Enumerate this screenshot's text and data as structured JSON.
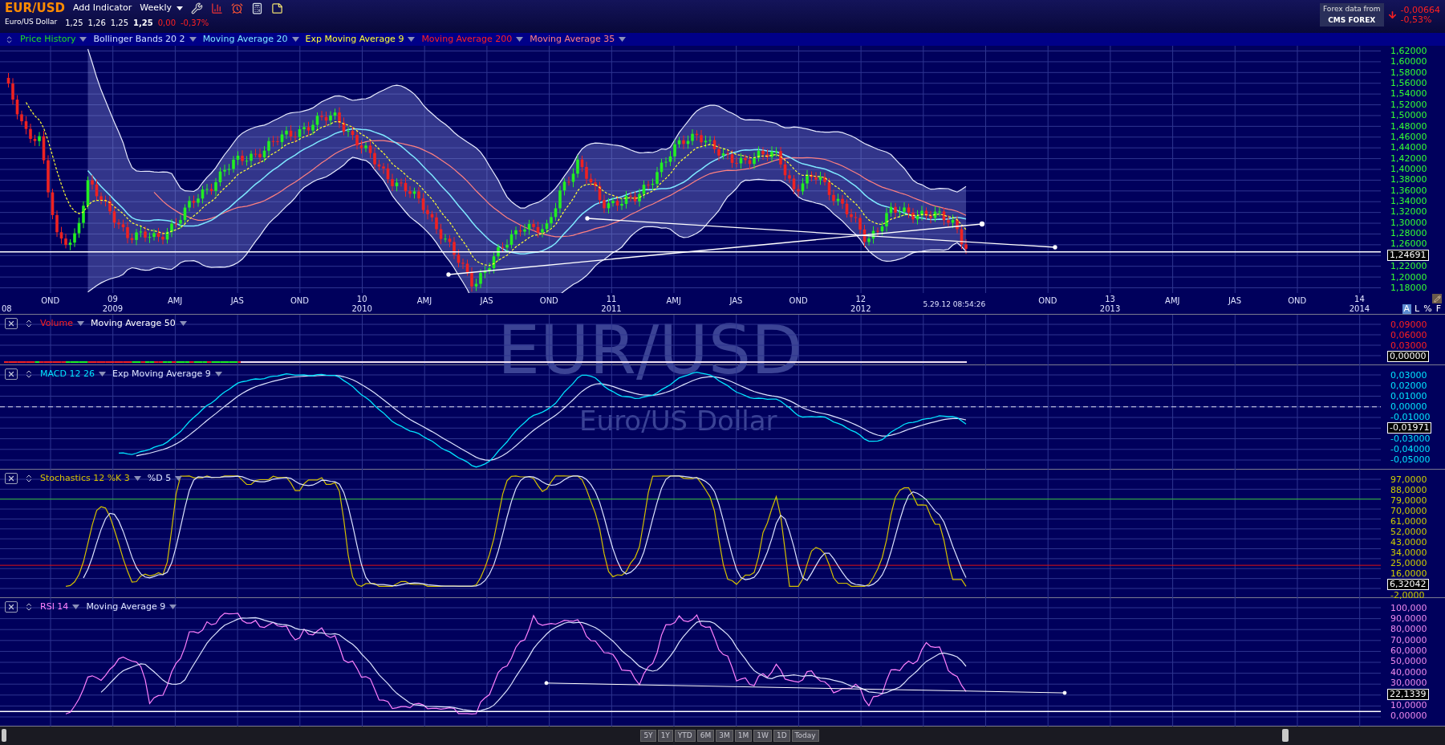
{
  "header": {
    "symbol": "EUR/USD",
    "add_indicator": "Add Indicator",
    "interval": "Weekly",
    "name": "Euro/US Dollar",
    "quote": [
      "1,25",
      "1,26",
      "1,25",
      "1,25"
    ],
    "change": "0,00",
    "change_percent": "-0,37%",
    "data_source": {
      "label": "Forex data from",
      "logo_text": "CMS FOREX"
    },
    "last_change": "-0,00664",
    "last_change_percent": "-0,53%"
  },
  "main_chart": {
    "indicators": [
      {
        "label": "Price History"
      },
      {
        "label": "Bollinger Bands 20 2"
      },
      {
        "label": "Moving Average 20"
      },
      {
        "label": "Exp Moving Average 9"
      },
      {
        "label": "Moving Average 200"
      },
      {
        "label": "Moving Average 35"
      }
    ],
    "y_axis": [
      {
        "kind": "tick",
        "label": "1,62000"
      },
      {
        "kind": "tick",
        "label": "1,60000"
      },
      {
        "kind": "tick",
        "label": "1,58000"
      },
      {
        "kind": "tick",
        "label": "1,56000"
      },
      {
        "kind": "tick",
        "label": "1,54000"
      },
      {
        "kind": "tick",
        "label": "1,52000"
      },
      {
        "kind": "tick",
        "label": "1,50000"
      },
      {
        "kind": "tick",
        "label": "1,48000"
      },
      {
        "kind": "tick",
        "label": "1,46000"
      },
      {
        "kind": "tick",
        "label": "1,44000"
      },
      {
        "kind": "tick",
        "label": "1,42000"
      },
      {
        "kind": "tick",
        "label": "1,40000"
      },
      {
        "kind": "tick",
        "label": "1,38000"
      },
      {
        "kind": "tick",
        "label": "1,36000"
      },
      {
        "kind": "tick",
        "label": "1,34000"
      },
      {
        "kind": "tick",
        "label": "1,32000"
      },
      {
        "kind": "tick",
        "label": "1,30000"
      },
      {
        "kind": "tick",
        "label": "1,28000"
      },
      {
        "kind": "tick",
        "label": "1,26000"
      },
      {
        "kind": "current",
        "label": "1,24691"
      },
      {
        "kind": "tick",
        "label": "1,22000"
      },
      {
        "kind": "tick",
        "label": "1,20000"
      },
      {
        "kind": "tick",
        "label": "1,18000"
      }
    ],
    "x_axis": [
      {
        "kind": "year",
        "year": "08"
      },
      {
        "kind": "quarter",
        "short": "OND"
      },
      {
        "kind": "year",
        "short": "09",
        "year": "2009"
      },
      {
        "kind": "quarter",
        "short": "AMJ"
      },
      {
        "kind": "quarter",
        "short": "JAS"
      },
      {
        "kind": "quarter",
        "short": "OND"
      },
      {
        "kind": "year",
        "short": "10",
        "year": "2010"
      },
      {
        "kind": "quarter",
        "short": "AMJ"
      },
      {
        "kind": "quarter",
        "short": "JAS"
      },
      {
        "kind": "quarter",
        "short": "OND"
      },
      {
        "kind": "year",
        "short": "11",
        "year": "2011"
      },
      {
        "kind": "quarter",
        "short": "AMJ"
      },
      {
        "kind": "quarter",
        "short": "JAS"
      },
      {
        "kind": "quarter",
        "short": "OND"
      },
      {
        "kind": "year",
        "short": "12",
        "year": "2012"
      },
      {
        "kind": "cursor",
        "short": "5.29.12 08:54:26"
      },
      {
        "kind": "quarter",
        "short": "OND"
      },
      {
        "kind": "year",
        "short": "13",
        "year": "2013"
      },
      {
        "kind": "quarter",
        "short": "AMJ"
      },
      {
        "kind": "quarter",
        "short": "JAS"
      },
      {
        "kind": "quarter",
        "short": "OND"
      },
      {
        "kind": "year",
        "short": "14",
        "year": "2014"
      }
    ],
    "scale_modes": [
      {
        "label": "A",
        "selected": true
      },
      {
        "label": "L",
        "selected": false
      },
      {
        "label": "%",
        "selected": false
      },
      {
        "label": "F",
        "selected": false
      }
    ]
  },
  "watermark": {
    "title": "EUR/USD",
    "subtitle": "Euro/US Dollar"
  },
  "panels": [
    {
      "kind": "volume",
      "indicators": [
        {
          "label": "Volume"
        },
        {
          "label": "Moving Average 50"
        }
      ],
      "y_axis": [
        {
          "kind": "tick",
          "label": "0,09000"
        },
        {
          "kind": "tick",
          "label": "0,06000"
        },
        {
          "kind": "tick",
          "label": "0,03000"
        },
        {
          "kind": "current",
          "label": "0,00000"
        }
      ]
    },
    {
      "kind": "macd",
      "indicators": [
        {
          "label": "MACD 12 26"
        },
        {
          "label": "Exp Moving Average 9"
        }
      ],
      "y_axis": [
        {
          "kind": "tick",
          "label": "0,03000"
        },
        {
          "kind": "tick",
          "label": "0,02000"
        },
        {
          "kind": "tick",
          "label": "0,01000"
        },
        {
          "kind": "tick",
          "label": "0,00000"
        },
        {
          "kind": "tick",
          "label": "-0,01000"
        },
        {
          "kind": "current",
          "label": "-0,01971"
        },
        {
          "kind": "tick",
          "label": "-0,03000"
        },
        {
          "kind": "tick",
          "label": "-0,04000"
        },
        {
          "kind": "tick",
          "label": "-0,05000"
        }
      ]
    },
    {
      "kind": "stochastics",
      "indicators": [
        {
          "label": "Stochastics 12 %K 3"
        },
        {
          "label": "%D 5"
        }
      ],
      "y_axis": [
        {
          "kind": "tick",
          "label": "97,0000"
        },
        {
          "kind": "tick",
          "label": "88,0000"
        },
        {
          "kind": "tick",
          "label": "79,0000"
        },
        {
          "kind": "tick",
          "label": "70,0000"
        },
        {
          "kind": "tick",
          "label": "61,0000"
        },
        {
          "kind": "tick",
          "label": "52,0000"
        },
        {
          "kind": "tick",
          "label": "43,0000"
        },
        {
          "kind": "tick",
          "label": "34,0000"
        },
        {
          "kind": "tick",
          "label": "25,0000"
        },
        {
          "kind": "tick",
          "label": "16,0000"
        },
        {
          "kind": "current",
          "label": "6,32042"
        },
        {
          "kind": "tick",
          "label": "-2,0000"
        }
      ]
    },
    {
      "kind": "rsi",
      "indicators": [
        {
          "label": "RSI 14"
        },
        {
          "label": "Moving Average 9"
        }
      ],
      "y_axis": [
        {
          "kind": "tick",
          "label": "100,000"
        },
        {
          "kind": "tick",
          "label": "90,0000"
        },
        {
          "kind": "tick",
          "label": "80,0000"
        },
        {
          "kind": "tick",
          "label": "70,0000"
        },
        {
          "kind": "tick",
          "label": "60,0000"
        },
        {
          "kind": "tick",
          "label": "50,0000"
        },
        {
          "kind": "tick",
          "label": "40,0000"
        },
        {
          "kind": "tick",
          "label": "30,0000"
        },
        {
          "kind": "current",
          "label": "22,1339"
        },
        {
          "kind": "tick",
          "label": "10,0000"
        },
        {
          "kind": "tick",
          "label": "0,00000"
        }
      ]
    }
  ],
  "range_buttons": [
    "5Y",
    "1Y",
    "YTD",
    "6M",
    "3M",
    "1M",
    "1W",
    "1D",
    "Today"
  ]
}
